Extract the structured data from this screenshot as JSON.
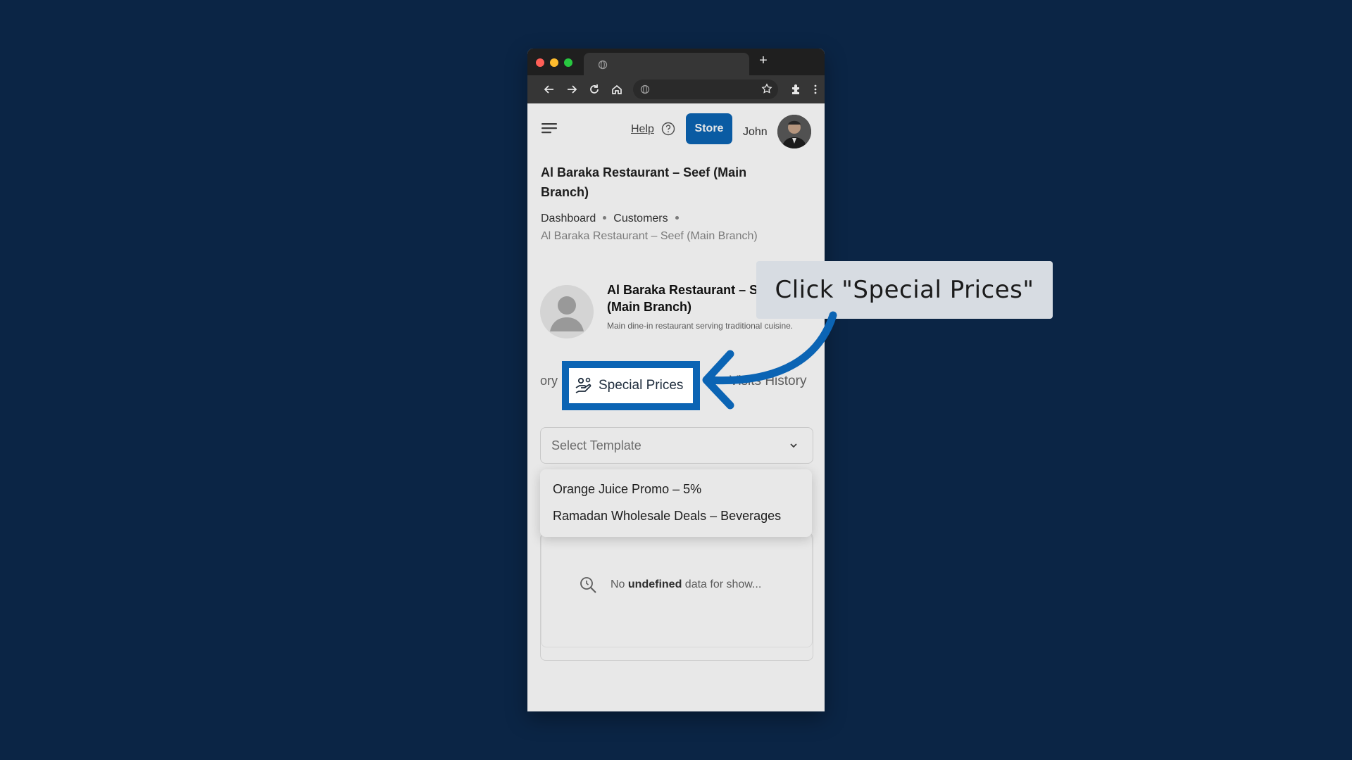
{
  "colors": {
    "background": "#0b2545",
    "accent": "#0b64b4",
    "callout_bg": "#d7dce2"
  },
  "header": {
    "help_label": "Help",
    "store_label": "Store",
    "user_name": "John"
  },
  "page": {
    "title": "Al Baraka Restaurant – Seef (Main Branch)",
    "breadcrumbs": [
      "Dashboard",
      "Customers"
    ],
    "breadcrumb_current": "Al Baraka Restaurant – Seef (Main Branch)"
  },
  "customer": {
    "name_line1": "Al Baraka Restaurant – Se",
    "name_line2": "(Main Branch)",
    "description": "Main dine-in restaurant serving traditional cuisine."
  },
  "tabs": {
    "previous_partial": "ory",
    "active": "Special Prices",
    "next": "Visits History"
  },
  "template_select": {
    "placeholder": "Select Template",
    "options": [
      "Orange Juice Promo – 5%",
      "Ramadan Wholesale Deals – Beverages"
    ]
  },
  "empty_state": {
    "prefix": "No",
    "bold": "undefined",
    "suffix": "data for show..."
  },
  "callout": {
    "text": "Click \"Special Prices\""
  }
}
